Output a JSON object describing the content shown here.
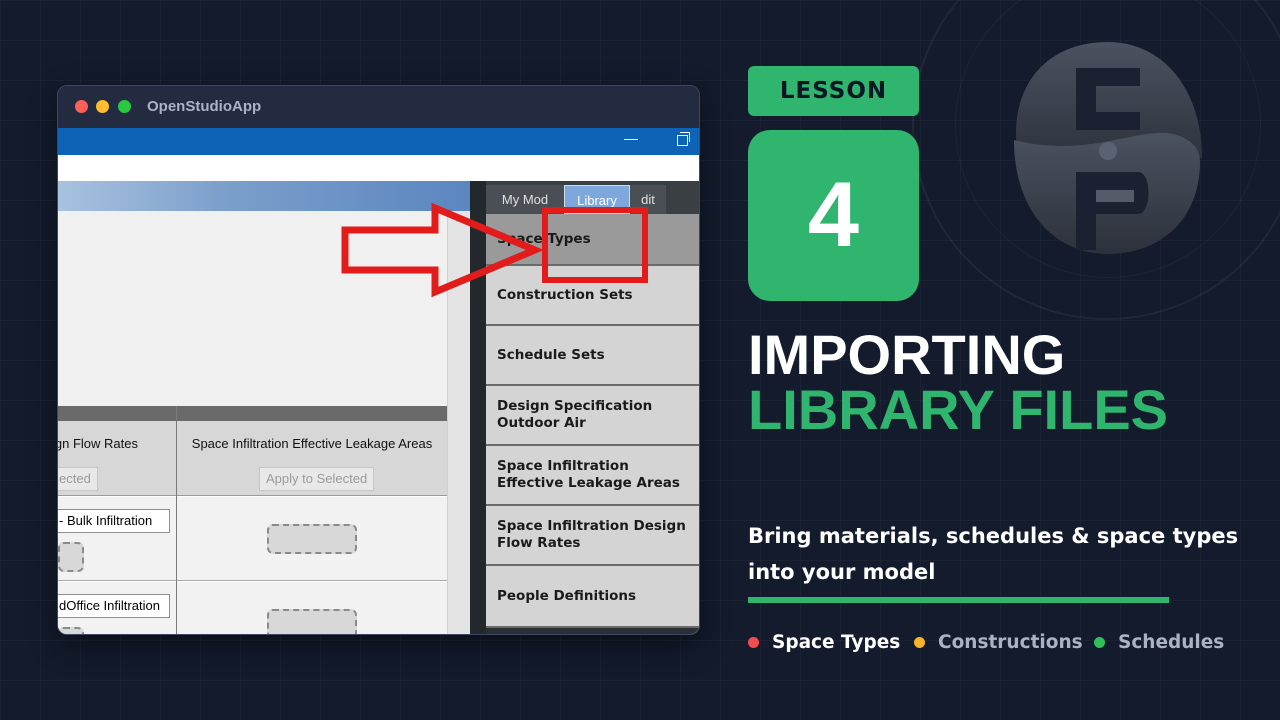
{
  "app": {
    "window_title": "OpenStudioApp"
  },
  "tabs": [
    {
      "label": "My Model",
      "visible_text": "My Mod"
    },
    {
      "label": "Library",
      "visible_text": "Library"
    },
    {
      "label": "Edit",
      "visible_text": "dit"
    }
  ],
  "library_items": [
    "Space Types",
    "Construction Sets",
    "Schedule Sets",
    "Design Specification Outdoor Air",
    "Space Infiltration Effective Leakage Areas",
    "Space Infiltration Design Flow Rates",
    "People Definitions"
  ],
  "grid": {
    "col1_header": "ign Flow Rates",
    "col1_apply": "ected",
    "col2_header": "Space Infiltration Effective Leakage Areas",
    "col2_apply": "Apply to Selected",
    "row1_value": "- Bulk Infiltration",
    "row2_value": "dOffice Infiltration"
  },
  "lesson": {
    "badge": "LESSON",
    "number": "4",
    "title_line1": "IMPORTING",
    "title_line2": "LIBRARY FILES",
    "subtitle_line1": "Bring materials, schedules & space types",
    "subtitle_line2": "into your model"
  },
  "legend": [
    {
      "label": "Space Types",
      "color": "#f04e4e",
      "text_color": "#ffffff"
    },
    {
      "label": "Constructions",
      "color": "#f6b42c",
      "text_color": "#aab3c4"
    },
    {
      "label": "Schedules",
      "color": "#2fc05a",
      "text_color": "#aab3c4"
    }
  ],
  "colors": {
    "accent": "#2fb56e",
    "highlight_red": "#e21b1b",
    "os_blue": "#0d63b5"
  },
  "icons": [
    "logo-mark",
    "arrow-right-icon",
    "minimize-icon",
    "maximize-icon",
    "scroll-up-icon"
  ]
}
